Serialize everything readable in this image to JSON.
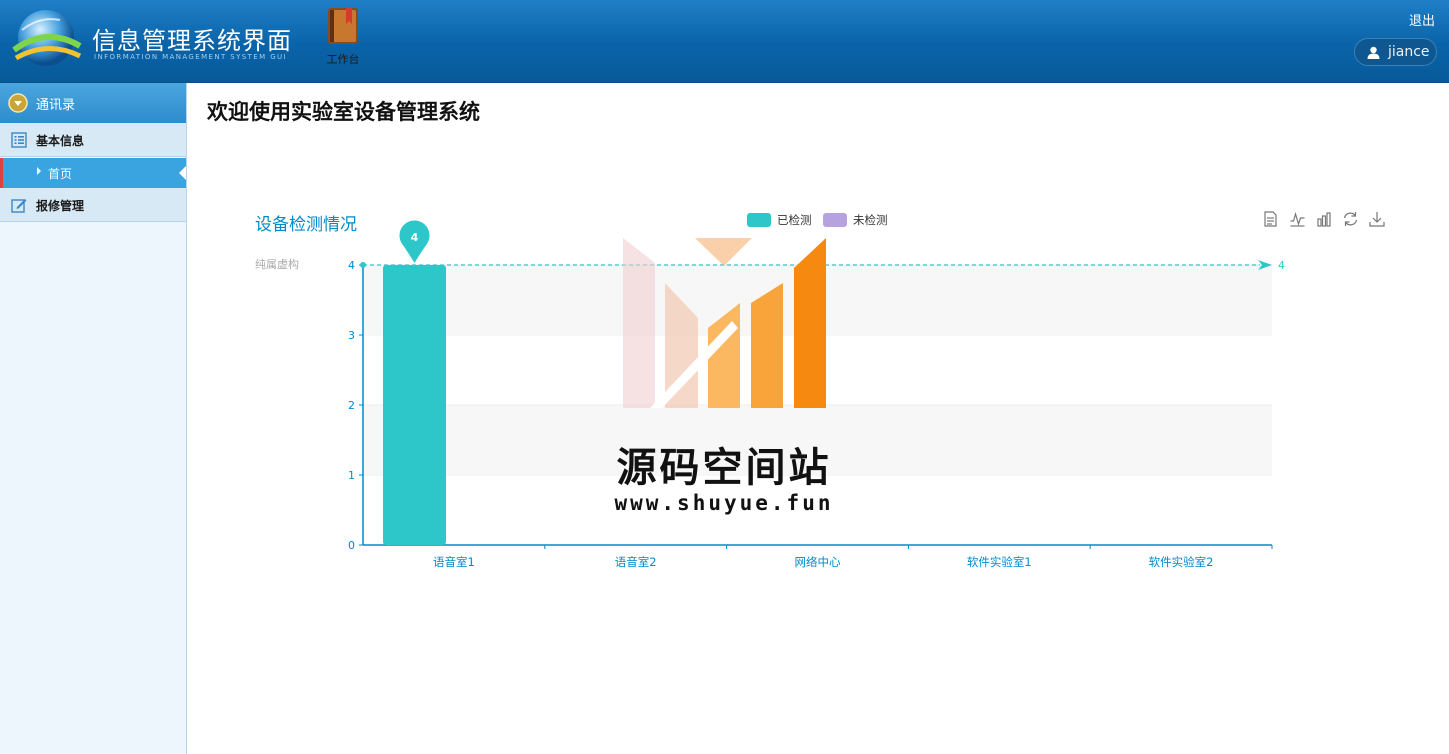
{
  "header": {
    "title": "信息管理系统界面",
    "subtitle": "INFORMATION MANAGEMENT SYSTEM GUI",
    "workbench_label": "工作台",
    "logout_label": "退出",
    "username": "jiance",
    "colors": {
      "bar_top": "#1f7fc6",
      "bar_bottom": "#075a9a"
    }
  },
  "sidebar": {
    "header_label": "通讯录",
    "groups": [
      {
        "label": "基本信息",
        "icon": "list-icon"
      },
      {
        "label": "报修管理",
        "icon": "edit-icon"
      }
    ],
    "sub_items": [
      {
        "label": "首页",
        "active": true
      }
    ]
  },
  "main": {
    "title": "欢迎使用实验室设备管理系统"
  },
  "toolbox": [
    "data-view-icon",
    "line-chart-icon",
    "bar-chart-icon",
    "restore-icon",
    "download-icon"
  ],
  "chart_data": {
    "type": "bar",
    "title": "设备检测情况",
    "subtitle": "纯属虚构",
    "categories": [
      "语音室1",
      "语音室2",
      "网络中心",
      "软件实验室1",
      "软件实验室2"
    ],
    "series": [
      {
        "name": "已检测",
        "color": "#2ec7c9",
        "values": [
          4,
          0,
          0,
          0,
          0
        ]
      },
      {
        "name": "未检测",
        "color": "#b6a2de",
        "values": [
          0,
          0,
          0,
          0,
          0
        ]
      }
    ],
    "ylim": [
      0,
      4
    ],
    "yticks": [
      0,
      1,
      2,
      3,
      4
    ],
    "max_pin": {
      "category": "语音室1",
      "value": 4
    },
    "mark_line": {
      "value": 4,
      "label": "4"
    },
    "legend_position": "top-center",
    "grid": "horizontal-bands"
  },
  "watermark": {
    "title": "源码空间站",
    "url": "www.shuyue.fun"
  }
}
